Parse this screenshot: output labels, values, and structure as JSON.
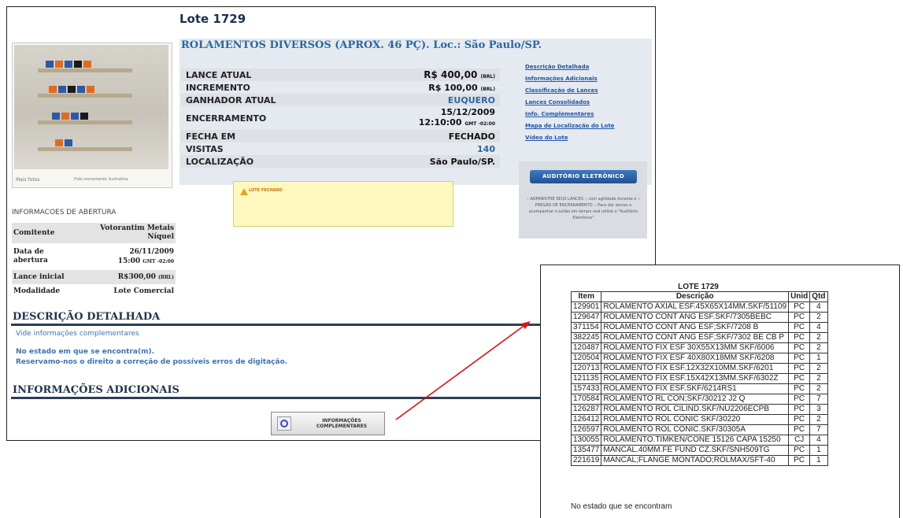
{
  "lote": {
    "title": "Lote 1729",
    "product_title": "ROLAMENTOS DIVERSOS (APROX. 46 PÇ). Loc.: São Paulo/SP."
  },
  "photo": {
    "more_photos": "Mais fotos",
    "caption": "Foto meramente ilustrativa"
  },
  "details": {
    "lance_atual_label": "LANCE ATUAL",
    "lance_atual_value": "R$ 400,00",
    "lance_atual_unit": "(BRL)",
    "incremento_label": "INCREMENTO",
    "incremento_value": "R$ 100,00",
    "incremento_unit": "(BRL)",
    "ganhador_label": "GANHADOR ATUAL",
    "ganhador_value": "EUQUERO",
    "encerramento_label": "ENCERRAMENTO",
    "encerramento_date": "15/12/2009",
    "encerramento_time": "12:10:00",
    "encerramento_tz": "GMT -02:00",
    "fecha_label": "FECHA EM",
    "fecha_value": "FECHADO",
    "visitas_label": "VISITAS",
    "visitas_value": "140",
    "localizacao_label": "LOCALIZAÇÃO",
    "localizacao_value": "São Paulo/SP."
  },
  "links": [
    "Descrição Detalhada",
    "Informações Adicionais",
    "Classificação de Lances",
    "Lances Consolidados",
    "Info. Complementares",
    "Mapa de Localização do Lote",
    "Vídeo do Lote"
  ],
  "auditorio": {
    "button": "AUDITÓRIO ELETRÔNICO",
    "note": ":: ADMINISTRE SEUS LANCES :: com agilidade durante o :: PREGÃO DE ENCERRAMENTO :: Para dar lances o acompanhar o Leilão em tempo real utilize o \"Auditório Eletrônico\""
  },
  "status": {
    "closed_label": "LOTE FECHADO"
  },
  "abertura": {
    "heading": "INFORMACOES DE ABERTURA",
    "comitente_label": "Comitente",
    "comitente_value": "Votorantim Metais Níquel",
    "data_label": "Data de abertura",
    "data_value": "26/11/2009",
    "hora_value": "15:00",
    "tz": "GMT -02:00",
    "lance_inicial_label": "Lance inicial",
    "lance_inicial_value": "R$300,00",
    "lance_inicial_unit": "(BRL)",
    "modalidade_label": "Modalidade",
    "modalidade_value": "Lote Comercial"
  },
  "descricao": {
    "heading": "DESCRIÇÃO DETALHADA",
    "line1": "Vide informações complementares",
    "line2": "No estado em que se encontra(m).",
    "line3": "Reservamo-nos o direito a correção de possíveis erros de digitação."
  },
  "adicionais": {
    "heading": "INFORMAÇÕES ADICIONAIS"
  },
  "info_button": {
    "line1": "INFORMAÇÕES",
    "line2": "COMPLEMENTARES"
  },
  "popup": {
    "title": "LOTE 1729",
    "headers": [
      "Item",
      "Descrição",
      "Unid",
      "Qtd"
    ],
    "rows": [
      [
        "129901",
        "ROLAMENTO AXIAL ESF.45X65X14MM.SKF/51109",
        "PC",
        "4"
      ],
      [
        "129647",
        "ROLAMENTO CONT ANG ESF.SKF/7305BEBC",
        "PC",
        "2"
      ],
      [
        "371154",
        "ROLAMENTO CONT ANG ESF;SKF/7208 B",
        "PC",
        "4"
      ],
      [
        "382245",
        "ROLAMENTO CONT ANG ESF;SKF/7302 BE CB P",
        "PC",
        "2"
      ],
      [
        "120487",
        "ROLAMENTO FIX ESF 30X55X13MM SKF/6006",
        "PC",
        "2"
      ],
      [
        "120504",
        "ROLAMENTO FIX ESF 40X80X18MM SKF/6208",
        "PC",
        "1"
      ],
      [
        "120713",
        "ROLAMENTO FIX ESF.12X32X10MM.SKF/6201",
        "PC",
        "2"
      ],
      [
        "121135",
        "ROLAMENTO FIX ESF.15X42X13MM.SKF/6302Z",
        "PC",
        "2"
      ],
      [
        "157433",
        "ROLAMENTO FIX ESF.SKF/6214RS1",
        "PC",
        "2"
      ],
      [
        "170584",
        "ROLAMENTO RL CON;SKF/30212 J2 Q",
        "PC",
        "7"
      ],
      [
        "126287",
        "ROLAMENTO ROL CILIND.SKF/NU2206ECPB",
        "PC",
        "3"
      ],
      [
        "126412",
        "ROLAMENTO ROL CONIC SKF/30220",
        "PC",
        "2"
      ],
      [
        "126597",
        "ROLAMENTO ROL CONIC.SKF/30305A",
        "PC",
        "7"
      ],
      [
        "130055",
        "ROLAMENTO.TIMKEN/CONE 15126 CAPA 15250",
        "CJ",
        "4"
      ],
      [
        "135477",
        "MANCAL.40MM.FE FUND CZ.SKF/SNH509TG",
        "PC",
        "1"
      ],
      [
        "221619",
        "MANCAL;FLANGE MONTADO;ROLMAX/SFT-40",
        "PC",
        "1"
      ]
    ],
    "footer": "No estado que se encontram"
  },
  "colors": {
    "accent_blue": "#2b67a2",
    "header_bg": "#e4eaf0",
    "closed_bg": "#fdf8be",
    "arrow": "#e01010"
  }
}
